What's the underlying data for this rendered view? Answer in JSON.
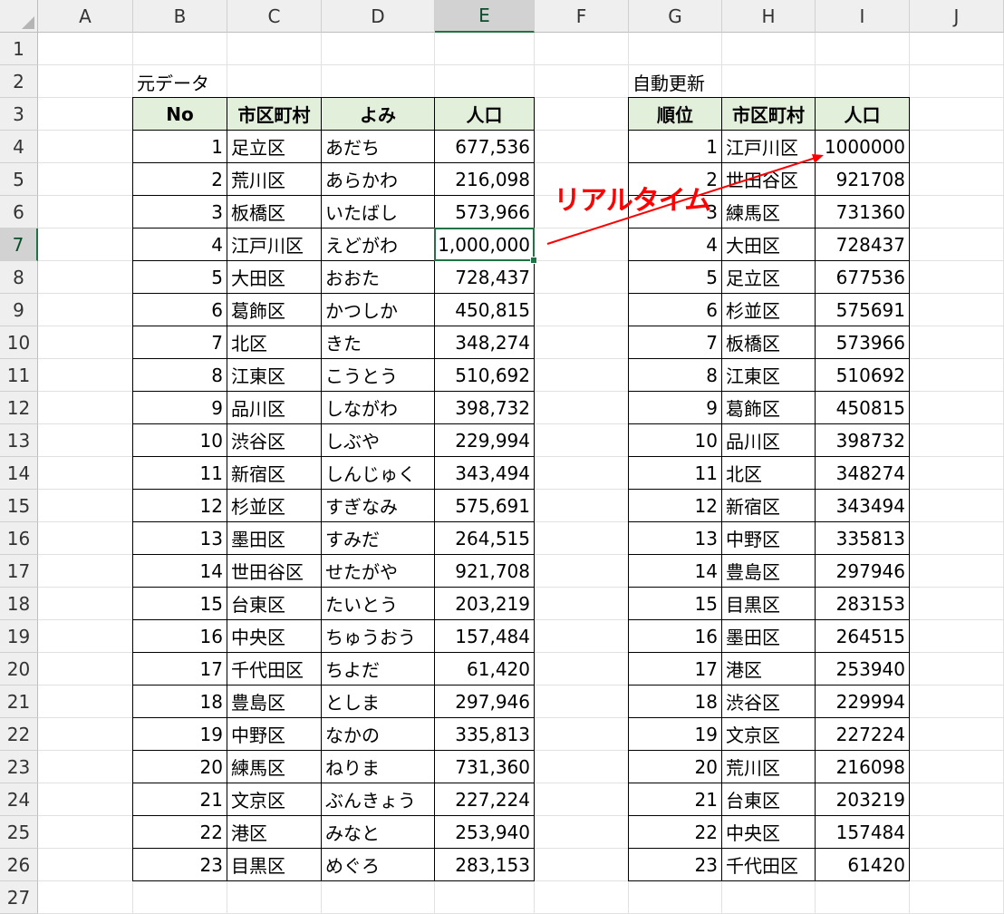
{
  "columns": [
    "A",
    "B",
    "C",
    "D",
    "E",
    "F",
    "G",
    "H",
    "I",
    "J"
  ],
  "rows": [
    "1",
    "2",
    "3",
    "4",
    "5",
    "6",
    "7",
    "8",
    "9",
    "10",
    "11",
    "12",
    "13",
    "14",
    "15",
    "16",
    "17",
    "18",
    "19",
    "20",
    "21",
    "22",
    "23",
    "24",
    "25",
    "26",
    "27"
  ],
  "left_table": {
    "title": "元データ",
    "headers": [
      "No",
      "市区町村",
      "よみ",
      "人口"
    ],
    "rows": [
      [
        "1",
        "足立区",
        "あだち",
        "677,536"
      ],
      [
        "2",
        "荒川区",
        "あらかわ",
        "216,098"
      ],
      [
        "3",
        "板橋区",
        "いたばし",
        "573,966"
      ],
      [
        "4",
        "江戸川区",
        "えどがわ",
        "1,000,000"
      ],
      [
        "5",
        "大田区",
        "おおた",
        "728,437"
      ],
      [
        "6",
        "葛飾区",
        "かつしか",
        "450,815"
      ],
      [
        "7",
        "北区",
        "きた",
        "348,274"
      ],
      [
        "8",
        "江東区",
        "こうとう",
        "510,692"
      ],
      [
        "9",
        "品川区",
        "しながわ",
        "398,732"
      ],
      [
        "10",
        "渋谷区",
        "しぶや",
        "229,994"
      ],
      [
        "11",
        "新宿区",
        "しんじゅく",
        "343,494"
      ],
      [
        "12",
        "杉並区",
        "すぎなみ",
        "575,691"
      ],
      [
        "13",
        "墨田区",
        "すみだ",
        "264,515"
      ],
      [
        "14",
        "世田谷区",
        "せたがや",
        "921,708"
      ],
      [
        "15",
        "台東区",
        "たいとう",
        "203,219"
      ],
      [
        "16",
        "中央区",
        "ちゅうおう",
        "157,484"
      ],
      [
        "17",
        "千代田区",
        "ちよだ",
        "61,420"
      ],
      [
        "18",
        "豊島区",
        "としま",
        "297,946"
      ],
      [
        "19",
        "中野区",
        "なかの",
        "335,813"
      ],
      [
        "20",
        "練馬区",
        "ねりま",
        "731,360"
      ],
      [
        "21",
        "文京区",
        "ぶんきょう",
        "227,224"
      ],
      [
        "22",
        "港区",
        "みなと",
        "253,940"
      ],
      [
        "23",
        "目黒区",
        "めぐろ",
        "283,153"
      ]
    ]
  },
  "right_table": {
    "title": "自動更新",
    "headers": [
      "順位",
      "市区町村",
      "人口"
    ],
    "rows": [
      [
        "1",
        "江戸川区",
        "1000000"
      ],
      [
        "2",
        "世田谷区",
        "921708"
      ],
      [
        "3",
        "練馬区",
        "731360"
      ],
      [
        "4",
        "大田区",
        "728437"
      ],
      [
        "5",
        "足立区",
        "677536"
      ],
      [
        "6",
        "杉並区",
        "575691"
      ],
      [
        "7",
        "板橋区",
        "573966"
      ],
      [
        "8",
        "江東区",
        "510692"
      ],
      [
        "9",
        "葛飾区",
        "450815"
      ],
      [
        "10",
        "品川区",
        "398732"
      ],
      [
        "11",
        "北区",
        "348274"
      ],
      [
        "12",
        "新宿区",
        "343494"
      ],
      [
        "13",
        "中野区",
        "335813"
      ],
      [
        "14",
        "豊島区",
        "297946"
      ],
      [
        "15",
        "目黒区",
        "283153"
      ],
      [
        "16",
        "墨田区",
        "264515"
      ],
      [
        "17",
        "港区",
        "253940"
      ],
      [
        "18",
        "渋谷区",
        "229994"
      ],
      [
        "19",
        "文京区",
        "227224"
      ],
      [
        "20",
        "荒川区",
        "216098"
      ],
      [
        "21",
        "台東区",
        "203219"
      ],
      [
        "22",
        "中央区",
        "157484"
      ],
      [
        "23",
        "千代田区",
        "61420"
      ]
    ]
  },
  "annotation": {
    "text": "リアルタイム",
    "color": "#ff0000"
  },
  "selection": {
    "active_cell": "E7",
    "selected_column": "E",
    "selected_row": "7"
  },
  "colors": {
    "header_fill": "#e2efda",
    "grid": "#e1e1e1",
    "accent": "#217346"
  }
}
